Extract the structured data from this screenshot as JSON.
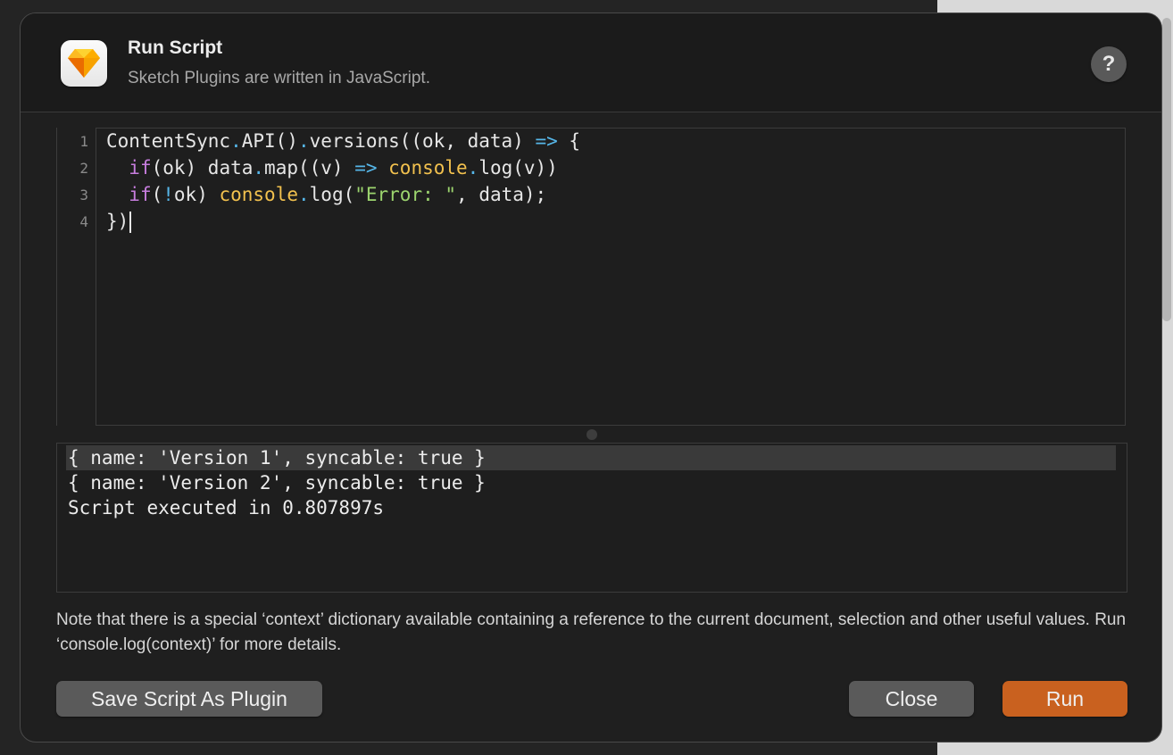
{
  "dialog": {
    "title": "Run Script",
    "subtitle": "Sketch Plugins are written in JavaScript.",
    "app_icon": "sketch-diamond-icon",
    "help_label": "?"
  },
  "editor": {
    "line_numbers": [
      "1",
      "2",
      "3",
      "4"
    ],
    "lines": [
      [
        {
          "t": "ContentSync",
          "c": "plain"
        },
        {
          "t": ".",
          "c": "op"
        },
        {
          "t": "API()",
          "c": "plain"
        },
        {
          "t": ".",
          "c": "op"
        },
        {
          "t": "versions((ok, data) ",
          "c": "plain"
        },
        {
          "t": "=>",
          "c": "op"
        },
        {
          "t": " {",
          "c": "plain"
        }
      ],
      [
        {
          "t": "  ",
          "c": "plain"
        },
        {
          "t": "if",
          "c": "kw"
        },
        {
          "t": "(ok) data",
          "c": "plain"
        },
        {
          "t": ".",
          "c": "op"
        },
        {
          "t": "map((v) ",
          "c": "plain"
        },
        {
          "t": "=>",
          "c": "op"
        },
        {
          "t": " ",
          "c": "plain"
        },
        {
          "t": "console",
          "c": "fn"
        },
        {
          "t": ".",
          "c": "op"
        },
        {
          "t": "log(v))",
          "c": "plain"
        }
      ],
      [
        {
          "t": "  ",
          "c": "plain"
        },
        {
          "t": "if",
          "c": "kw"
        },
        {
          "t": "(",
          "c": "plain"
        },
        {
          "t": "!",
          "c": "op"
        },
        {
          "t": "ok) ",
          "c": "plain"
        },
        {
          "t": "console",
          "c": "fn"
        },
        {
          "t": ".",
          "c": "op"
        },
        {
          "t": "log(",
          "c": "plain"
        },
        {
          "t": "\"Error: \"",
          "c": "str"
        },
        {
          "t": ", data);",
          "c": "plain"
        }
      ],
      [
        {
          "t": "})",
          "c": "plain"
        }
      ]
    ]
  },
  "output": {
    "lines": [
      "{ name: 'Version 1', syncable: true }",
      "{ name: 'Version 2', syncable: true }",
      "Script executed in 0.807897s"
    ]
  },
  "note": "Note that there is a special ‘context’ dictionary available containing a reference to the current document, selection and other useful values. Run ‘console.log(context)’ for more details.",
  "buttons": {
    "save_label": "Save Script As Plugin",
    "close_label": "Close",
    "run_label": "Run"
  },
  "colors": {
    "accent": "#c9611f",
    "keyword": "#c77dde",
    "function": "#f2c14e",
    "operator": "#56b6e8",
    "string": "#9cd46e"
  }
}
